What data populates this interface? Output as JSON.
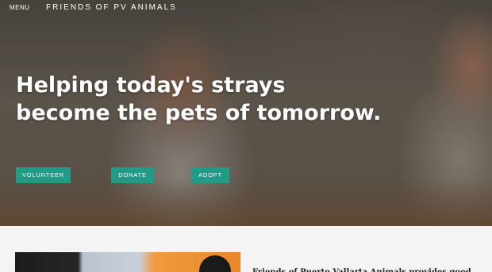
{
  "header": {
    "menu_label": "MENU",
    "brand": "FRIENDS OF PV ANIMALS"
  },
  "hero": {
    "headline_line1": "Helping today's strays",
    "headline_line2": "become the pets of tomorrow.",
    "buttons": {
      "volunteer": "VOLUNTEER",
      "donate": "DONATE",
      "adopt": "ADOPT"
    },
    "accent_color": "#1f9b86"
  },
  "content": {
    "intro_text": "Friends of Puerto Vallarta Animals provides good"
  }
}
